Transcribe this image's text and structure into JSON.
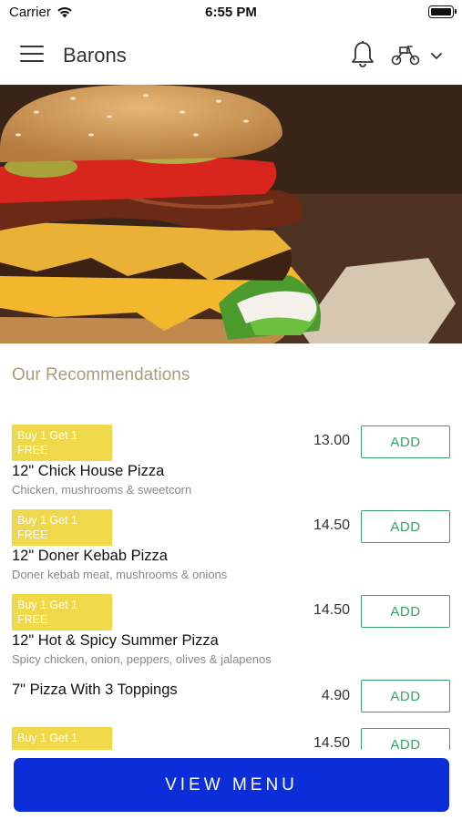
{
  "status_bar": {
    "carrier": "Carrier",
    "time": "6:55 PM"
  },
  "header": {
    "title": "Barons",
    "icons": [
      "menu-icon",
      "bell-icon",
      "scooter-icon",
      "chevron-down-icon"
    ]
  },
  "hero": {
    "image": "burger-photo"
  },
  "recommendations": {
    "title": "Our Recommendations",
    "items": [
      {
        "badge_line1": "Buy 1 Get 1",
        "badge_line2": "FREE",
        "name": "12\" Chick House Pizza",
        "desc": "Chicken, mushrooms & sweetcorn",
        "price": "13.00",
        "button": "ADD"
      },
      {
        "badge_line1": "Buy 1 Get 1",
        "badge_line2": "FREE",
        "name": "12\" Doner Kebab Pizza",
        "desc": "Doner kebab meat, mushrooms & onions",
        "price": "14.50",
        "button": "ADD"
      },
      {
        "badge_line1": "Buy 1 Get 1",
        "badge_line2": "FREE",
        "name": "12\" Hot & Spicy Summer Pizza",
        "desc": "Spicy chicken, onion, peppers, olives & jalapenos",
        "price": "14.50",
        "button": "ADD"
      },
      {
        "name": "7\" Pizza With 3 Toppings",
        "price": "4.90",
        "button": "ADD"
      },
      {
        "badge_line1": "Buy 1 Get 1",
        "price": "14.50",
        "button": "ADD"
      }
    ]
  },
  "footer": {
    "view_menu": "VIEW MENU"
  },
  "colors": {
    "accent": "#0b2ed8",
    "badge": "#efd84a",
    "add_button": "#3aa06a",
    "section_title": "#a99c7c"
  }
}
